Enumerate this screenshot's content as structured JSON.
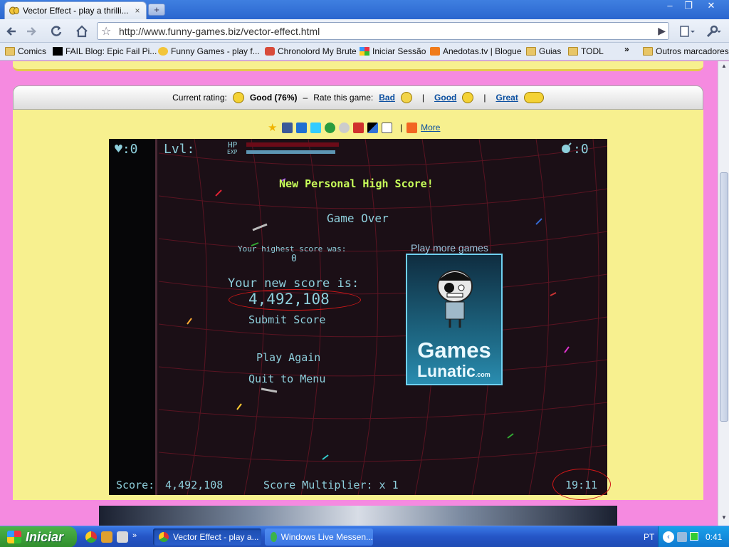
{
  "browser": {
    "tab_title": "Vector Effect - play a thrilli...",
    "tab_close": "×",
    "new_tab": "+",
    "window_controls": {
      "minimize": "–",
      "maximize": "❐",
      "close": "✕"
    },
    "url": "http://www.funny-games.biz/vector-effect.html",
    "bookmarks": [
      "Comics",
      "FAIL Blog: Epic Fail Pi...",
      "Funny Games - play f...",
      "Chronolord My Brute",
      "Iniciar Sessão",
      "Anedotas.tv | Blogue",
      "Guias",
      "TODL"
    ],
    "bookmarks_overflow": "»",
    "other_bookmarks": "Outros marcadores"
  },
  "rating": {
    "label": "Current rating:",
    "value": "Good (76%)",
    "separator": "–",
    "rate_label": "Rate this game:",
    "bad": "Bad",
    "good": "Good",
    "great": "Great",
    "pipe": "|"
  },
  "share": {
    "more": "More",
    "pipe": "|"
  },
  "game": {
    "lives": "♥:0",
    "level_label": "Lvl:",
    "hp_label": "HP",
    "exp_label": "EXP",
    "bombs": ":0",
    "high_score_msg": "New Personal High Score!",
    "game_over": "Game Over",
    "highest_label": "Your highest score was:",
    "highest_value": "0",
    "new_score_label": "Your new score is:",
    "new_score_value": "4,492,108",
    "submit": "Submit Score",
    "play_again": "Play Again",
    "quit": "Quit to Menu",
    "play_more": "Play more games",
    "ad_line1": "Games",
    "ad_line2": "Lunatic",
    "ad_suffix": ".com",
    "score_label": "Score:",
    "score_value": "4,492,108",
    "multiplier": "Score Multiplier: x 1",
    "timer": "19:11"
  },
  "taskbar": {
    "start": "Iniciar",
    "quicklaunch_more": "»",
    "tasks": [
      "Vector Effect - play a...",
      "Windows Live Messen..."
    ],
    "lang": "PT",
    "clock": "0:41"
  }
}
